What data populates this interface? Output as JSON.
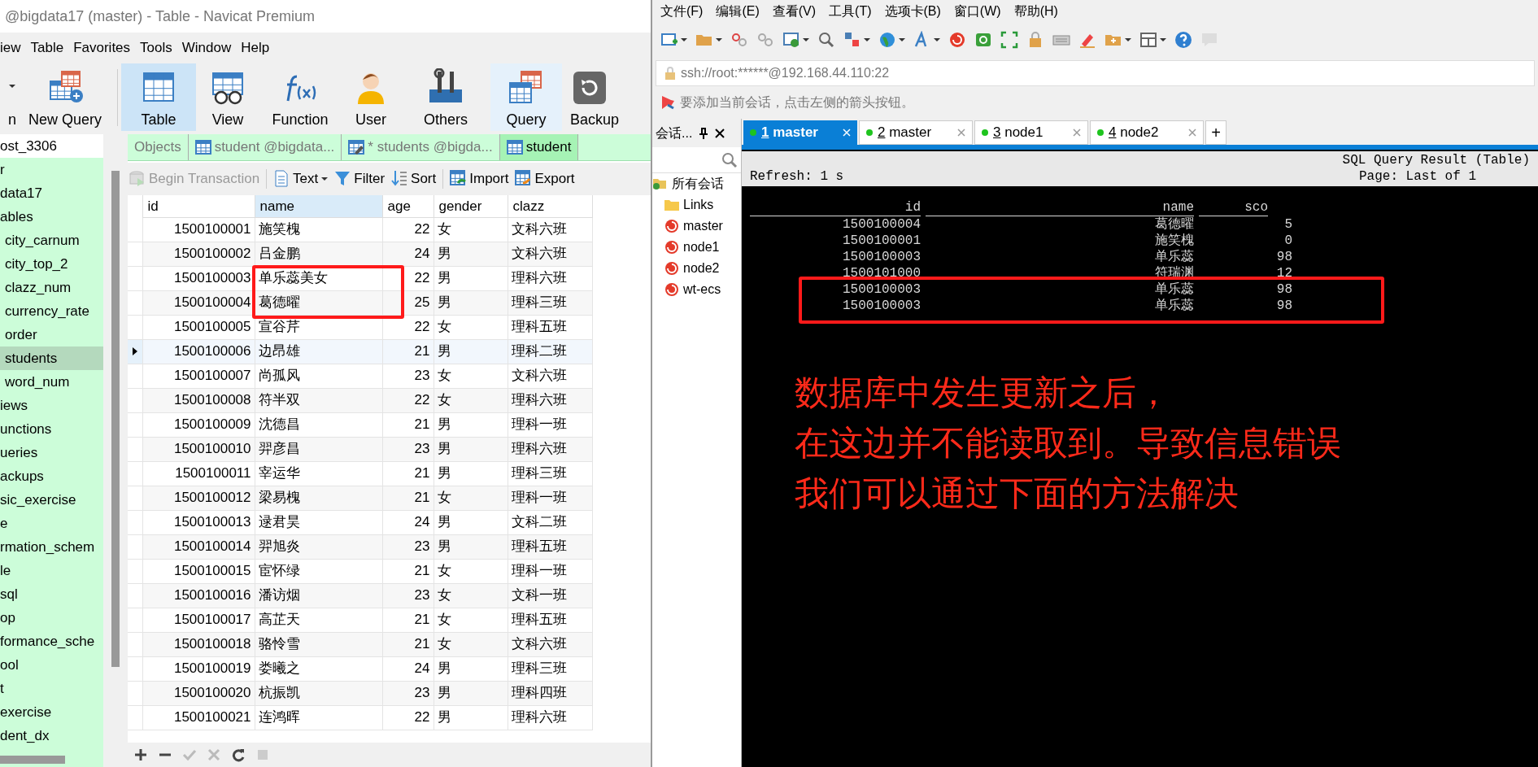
{
  "navicat": {
    "title": "@bigdata17 (master) - Table - Navicat Premium",
    "menu": [
      "iew",
      "Table",
      "Favorites",
      "Tools",
      "Window",
      "Help"
    ],
    "toolbar": [
      {
        "label": "n",
        "kind": "cut",
        "selected": false
      },
      {
        "label": "New Query",
        "kind": "newquery",
        "selected": false
      },
      {
        "label": "Table",
        "kind": "table",
        "selected": true
      },
      {
        "label": "View",
        "kind": "view",
        "selected": false
      },
      {
        "label": "Function",
        "kind": "function",
        "selected": false
      },
      {
        "label": "User",
        "kind": "user",
        "selected": false
      },
      {
        "label": "Others",
        "kind": "others",
        "selected": false
      },
      {
        "label": "Query",
        "kind": "query",
        "selected": false
      },
      {
        "label": "Backup",
        "kind": "backup",
        "selected": false
      }
    ],
    "sidebar": {
      "items": [
        {
          "label": "ost_3306",
          "selected": false
        },
        {
          "label": "r",
          "selected": false
        },
        {
          "label": "data17",
          "selected": false,
          "children": [
            {
              "label": "ables",
              "selected": false,
              "children": [
                {
                  "label": "city_carnum",
                  "selected": false
                },
                {
                  "label": "city_top_2",
                  "selected": false
                },
                {
                  "label": "clazz_num",
                  "selected": false
                },
                {
                  "label": "currency_rate",
                  "selected": false
                },
                {
                  "label": "order",
                  "selected": false
                },
                {
                  "label": "students",
                  "selected": true
                },
                {
                  "label": "word_num",
                  "selected": false
                }
              ]
            },
            {
              "label": "iews",
              "selected": false
            },
            {
              "label": "unctions",
              "selected": false
            },
            {
              "label": "ueries",
              "selected": false
            },
            {
              "label": "ackups",
              "selected": false
            }
          ]
        },
        {
          "label": "sic_exercise",
          "selected": false
        },
        {
          "label": "e",
          "selected": false
        },
        {
          "label": "rmation_schem",
          "selected": false
        },
        {
          "label": "le",
          "selected": false
        },
        {
          "label": "sql",
          "selected": false
        },
        {
          "label": "op",
          "selected": false
        },
        {
          "label": "formance_sche",
          "selected": false
        },
        {
          "label": "ool",
          "selected": false
        },
        {
          "label": "t",
          "selected": false
        },
        {
          "label": "exercise",
          "selected": false
        },
        {
          "label": "dent_dx",
          "selected": false
        }
      ]
    },
    "tabs": [
      {
        "label": "Objects",
        "kind": "plain",
        "selected": false
      },
      {
        "label": "student @bigdata...",
        "kind": "table",
        "selected": false
      },
      {
        "label": "* students @bigda...",
        "kind": "edit",
        "selected": false
      },
      {
        "label": "student",
        "kind": "table",
        "selected": true
      }
    ],
    "actions": [
      {
        "label": "Begin Transaction",
        "kind": "transaction",
        "disabled": true
      },
      {
        "label": "Text",
        "kind": "text",
        "disabled": false
      },
      {
        "label": "Filter",
        "kind": "filter",
        "disabled": false
      },
      {
        "label": "Sort",
        "kind": "sort",
        "disabled": false
      },
      {
        "label": "Import",
        "kind": "import",
        "disabled": false
      },
      {
        "label": "Export",
        "kind": "export",
        "disabled": false
      }
    ],
    "table": {
      "columns": [
        {
          "label": "id",
          "selected": false
        },
        {
          "label": "name",
          "selected": true
        },
        {
          "label": "age",
          "selected": false
        },
        {
          "label": "gender",
          "selected": false
        },
        {
          "label": "clazz",
          "selected": false
        }
      ],
      "rows": [
        {
          "cells": [
            "1500100001",
            "施笑槐",
            "22",
            "女",
            "文科六班"
          ],
          "selected": false
        },
        {
          "cells": [
            "1500100002",
            "吕金鹏",
            "24",
            "男",
            "文科六班"
          ],
          "selected": false
        },
        {
          "cells": [
            "1500100003",
            "单乐蕊美女",
            "22",
            "男",
            "理科六班"
          ],
          "selected": false
        },
        {
          "cells": [
            "1500100004",
            "葛德曜",
            "25",
            "男",
            "理科三班"
          ],
          "selected": false
        },
        {
          "cells": [
            "1500100005",
            "宣谷芹",
            "22",
            "女",
            "理科五班"
          ],
          "selected": false
        },
        {
          "cells": [
            "1500100006",
            "边昂雄",
            "21",
            "男",
            "理科二班"
          ],
          "selected": true
        },
        {
          "cells": [
            "1500100007",
            "尚孤风",
            "23",
            "女",
            "文科六班"
          ],
          "selected": false
        },
        {
          "cells": [
            "1500100008",
            "符半双",
            "22",
            "女",
            "理科六班"
          ],
          "selected": false
        },
        {
          "cells": [
            "1500100009",
            "沈德昌",
            "21",
            "男",
            "理科一班"
          ],
          "selected": false
        },
        {
          "cells": [
            "1500100010",
            "羿彦昌",
            "23",
            "男",
            "理科六班"
          ],
          "selected": false
        },
        {
          "cells": [
            "1500100011",
            "宰运华",
            "21",
            "男",
            "理科三班"
          ],
          "selected": false
        },
        {
          "cells": [
            "1500100012",
            "梁易槐",
            "21",
            "女",
            "理科一班"
          ],
          "selected": false
        },
        {
          "cells": [
            "1500100013",
            "逯君昊",
            "24",
            "男",
            "文科二班"
          ],
          "selected": false
        },
        {
          "cells": [
            "1500100014",
            "羿旭炎",
            "23",
            "男",
            "理科五班"
          ],
          "selected": false
        },
        {
          "cells": [
            "1500100015",
            "宦怀绿",
            "21",
            "女",
            "理科一班"
          ],
          "selected": false
        },
        {
          "cells": [
            "1500100016",
            "潘访烟",
            "23",
            "女",
            "文科一班"
          ],
          "selected": false
        },
        {
          "cells": [
            "1500100017",
            "高芷天",
            "21",
            "女",
            "理科五班"
          ],
          "selected": false
        },
        {
          "cells": [
            "1500100018",
            "骆怜雪",
            "21",
            "女",
            "文科六班"
          ],
          "selected": false
        },
        {
          "cells": [
            "1500100019",
            "娄曦之",
            "24",
            "男",
            "理科三班"
          ],
          "selected": false
        },
        {
          "cells": [
            "1500100020",
            "杭振凯",
            "23",
            "男",
            "理科四班"
          ],
          "selected": false
        },
        {
          "cells": [
            "1500100021",
            "连鸿晖",
            "22",
            "男",
            "理科六班"
          ],
          "selected": false
        }
      ]
    }
  },
  "xshell": {
    "menu": [
      "文件(F)",
      "编辑(E)",
      "查看(V)",
      "工具(T)",
      "选项卡(B)",
      "窗口(W)",
      "帮助(H)"
    ],
    "address": "ssh://root:******@192.168.44.110:22",
    "hint": "要添加当前会话，点击左侧的箭头按钮。",
    "session_panel": {
      "title": "会话...",
      "tree": [
        {
          "label": "所有会话",
          "kind": "root",
          "children": [
            {
              "label": "Links",
              "kind": "folder"
            },
            {
              "label": "master",
              "kind": "session"
            },
            {
              "label": "node1",
              "kind": "session"
            },
            {
              "label": "node2",
              "kind": "session"
            },
            {
              "label": "wt-ecs",
              "kind": "session"
            }
          ]
        }
      ]
    },
    "tabs": [
      {
        "number": "1",
        "label": "master",
        "selected": true
      },
      {
        "number": "2",
        "label": "master",
        "selected": false
      },
      {
        "number": "3",
        "label": "node1",
        "selected": false
      },
      {
        "number": "4",
        "label": "node2",
        "selected": false
      }
    ],
    "new_tab": "+",
    "terminal": {
      "title": "SQL Query Result (Table)",
      "refresh": "Refresh: 1 s",
      "page": "Page: Last of 1",
      "columns": [
        "id",
        "name",
        "sco"
      ],
      "rows": [
        [
          "1500100004",
          "葛德曜",
          "5"
        ],
        [
          "1500100001",
          "施笑槐",
          "0"
        ],
        [
          "1500100003",
          "单乐蕊",
          "98"
        ],
        [
          "1500101000",
          "符瑞渊",
          "12"
        ],
        [
          "1500100003",
          "单乐蕊",
          "98"
        ],
        [
          "1500100003",
          "单乐蕊",
          "98"
        ]
      ],
      "note": [
        "数据库中发生更新之后，",
        "在这边并不能读取到。导致信息错误",
        "我们可以通过下面的方法解决"
      ]
    }
  }
}
